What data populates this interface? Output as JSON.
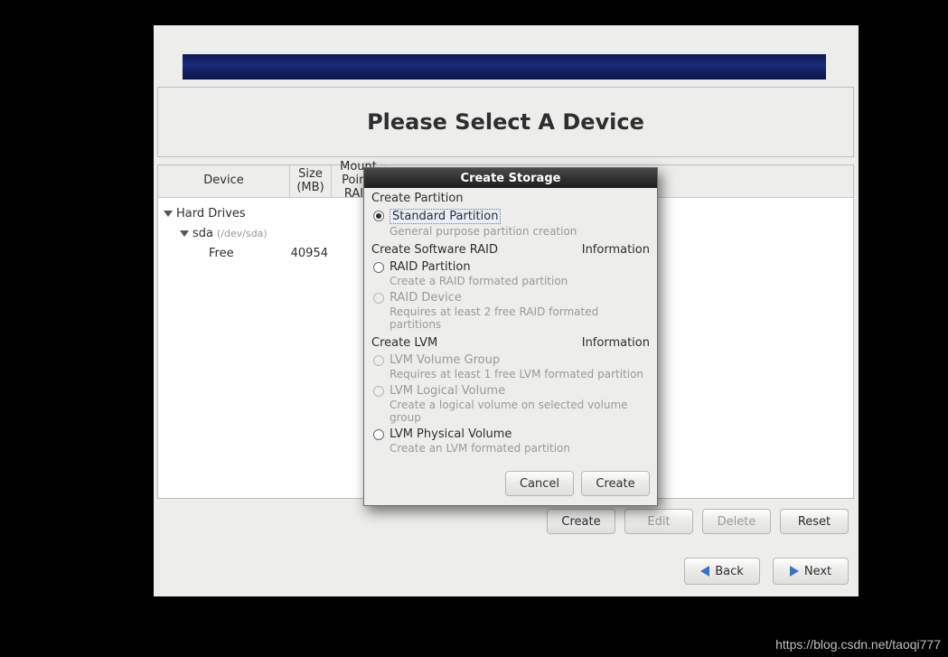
{
  "title_panel": {
    "heading": "Please Select A Device"
  },
  "columns": {
    "device": "Device",
    "size": "Size\n(MB)",
    "mount": "Mount Point/\nRAID"
  },
  "tree": {
    "root_label": "Hard Drives",
    "disk_label": "sda",
    "disk_path": "(/dev/sda)",
    "free_label": "Free",
    "free_size": "40954"
  },
  "buttons": {
    "create": "Create",
    "edit": "Edit",
    "delete": "Delete",
    "reset": "Reset",
    "back": "Back",
    "next": "Next"
  },
  "dialog": {
    "title": "Create Storage",
    "section_partition": "Create Partition",
    "opt_standard": "Standard Partition",
    "opt_standard_desc": "General purpose partition creation",
    "section_raid": "Create Software RAID",
    "info": "Information",
    "opt_raid_part": "RAID Partition",
    "opt_raid_part_desc": "Create a RAID formated partition",
    "opt_raid_dev": "RAID Device",
    "opt_raid_dev_desc": "Requires at least 2 free RAID formated partitions",
    "section_lvm": "Create LVM",
    "opt_lvm_vg": "LVM Volume Group",
    "opt_lvm_vg_desc": "Requires at least 1 free LVM formated partition",
    "opt_lvm_lv": "LVM Logical Volume",
    "opt_lvm_lv_desc": "Create a logical volume on selected volume group",
    "opt_lvm_pv": "LVM Physical Volume",
    "opt_lvm_pv_desc": "Create an LVM formated partition",
    "cancel": "Cancel",
    "create": "Create"
  },
  "watermark": "https://blog.csdn.net/taoqi777"
}
